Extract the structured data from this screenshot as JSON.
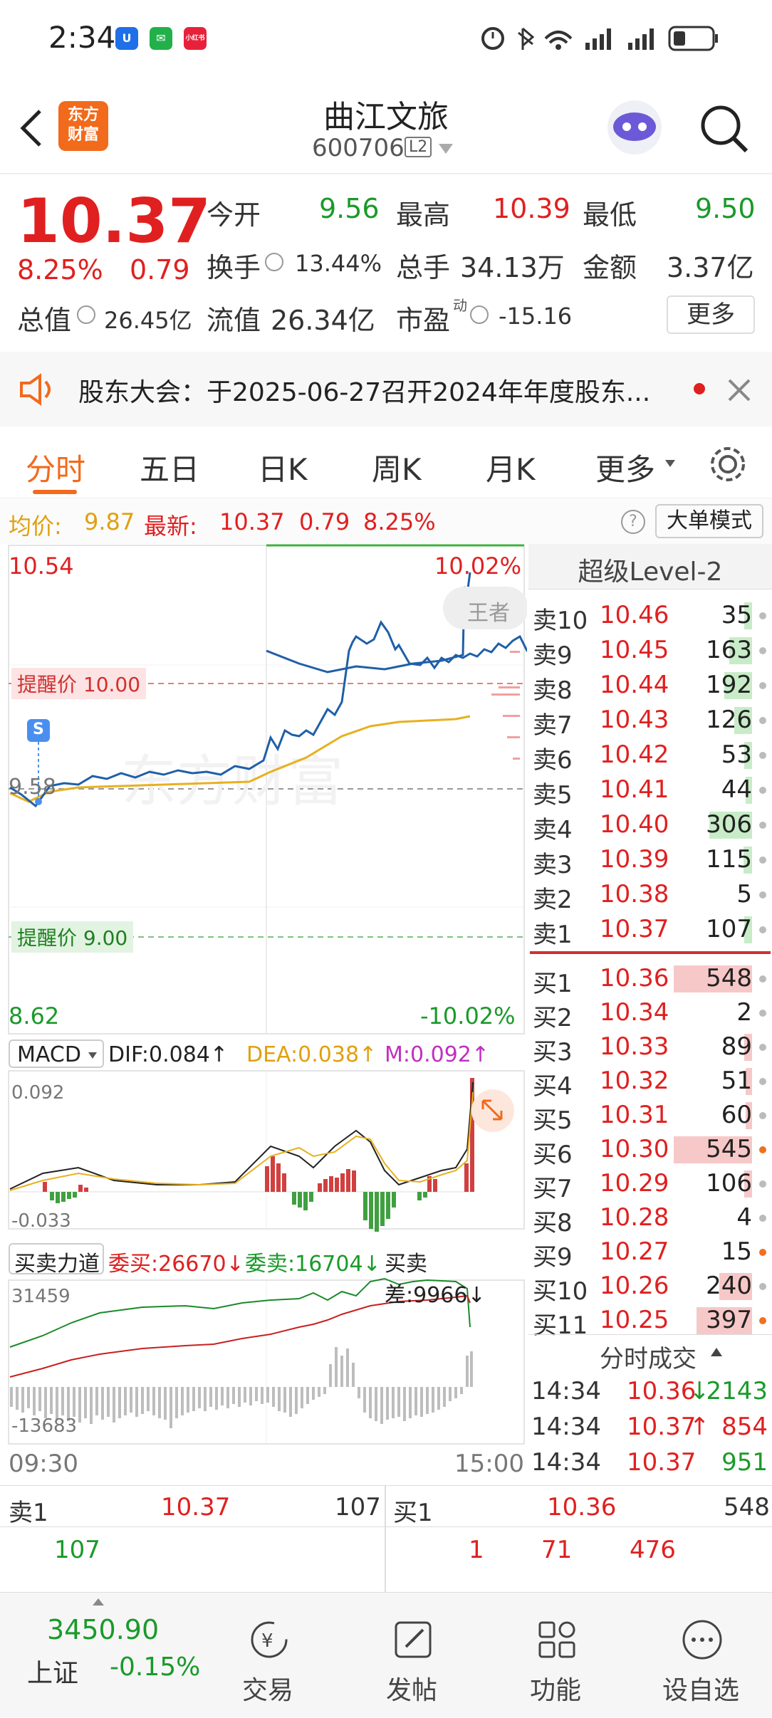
{
  "status_bar": {
    "time": "2:34",
    "badges": [
      "u-app-icon",
      "wechat-icon",
      "xiaohongshu-icon"
    ],
    "badge3_text": "小红书"
  },
  "header": {
    "back": "back-arrow",
    "logo_text_1": "东方",
    "logo_text_2": "财富",
    "stock_name": "曲江文旅",
    "stock_code": "600706",
    "level_tag": "L2"
  },
  "quote": {
    "price": "10.37",
    "pct": "8.25%",
    "change": "0.79",
    "open_label": "今开",
    "open": "9.56",
    "high_label": "最高",
    "high": "10.39",
    "low_label": "最低",
    "low": "9.50",
    "turnover_label": "换手",
    "turnover": "13.44%",
    "volume_label": "总手",
    "volume": "34.13万",
    "amount_label": "金额",
    "amount": "3.37亿",
    "mktcap_label": "总值",
    "mktcap": "26.45亿",
    "float_label": "流值",
    "float": "26.34亿",
    "pe_label": "市盈",
    "pe_sup": "动",
    "pe": "-15.16",
    "more": "更多"
  },
  "notice": {
    "text": "股东大会：于2025-06-27召开2024年年度股东..."
  },
  "tabs": [
    "分时",
    "五日",
    "日K",
    "周K",
    "月K",
    "更多"
  ],
  "infoline": {
    "avg_label": "均价:",
    "avg": "9.87",
    "latest_label": "最新:",
    "latest": "10.37",
    "chg": "0.79",
    "pct": "8.25%",
    "mode": "大单模式"
  },
  "chart": {
    "ymax": "10.54",
    "ymax_pct": "10.02%",
    "ymin": "8.62",
    "ymin_pct": "-10.02%",
    "alert_high": "提醒价 10.00",
    "alert_low": "提醒价 9.00",
    "ref": "9.58",
    "watermark": "东方财富",
    "overlay_tag": "王者",
    "s_marker": "S",
    "t_start": "09:30",
    "t_end": "15:00"
  },
  "macd": {
    "name": "MACD",
    "dif": "DIF:0.084",
    "dea": "DEA:0.038",
    "m": "M:0.092",
    "top": "0.092",
    "bottom": "-0.033"
  },
  "force": {
    "name": "买卖力道",
    "buy": "委买:26670",
    "sell": "委卖:16704",
    "diff": "买卖差:9966",
    "top": "31459",
    "bottom": "-13683"
  },
  "level2": {
    "title": "超级Level-2",
    "asks": [
      {
        "label": "卖10",
        "price": "10.46",
        "vol": "35",
        "w": 0.06
      },
      {
        "label": "卖9",
        "price": "10.45",
        "vol": "163",
        "w": 0.18
      },
      {
        "label": "卖8",
        "price": "10.44",
        "vol": "192",
        "w": 0.22
      },
      {
        "label": "卖7",
        "price": "10.43",
        "vol": "126",
        "w": 0.14
      },
      {
        "label": "卖6",
        "price": "10.42",
        "vol": "53",
        "w": 0.06
      },
      {
        "label": "卖5",
        "price": "10.41",
        "vol": "44",
        "w": 0.05
      },
      {
        "label": "卖4",
        "price": "10.40",
        "vol": "306",
        "w": 0.34
      },
      {
        "label": "卖3",
        "price": "10.39",
        "vol": "115",
        "w": 0.07
      },
      {
        "label": "卖2",
        "price": "10.38",
        "vol": "5",
        "w": 0.0
      },
      {
        "label": "卖1",
        "price": "10.37",
        "vol": "107",
        "w": 0.06
      }
    ],
    "bids": [
      {
        "label": "买1",
        "price": "10.36",
        "vol": "548",
        "w": 0.62,
        "dot": "gray"
      },
      {
        "label": "买2",
        "price": "10.34",
        "vol": "2",
        "w": 0.0,
        "dot": "gray"
      },
      {
        "label": "买3",
        "price": "10.33",
        "vol": "89",
        "w": 0.06,
        "dot": "gray"
      },
      {
        "label": "买4",
        "price": "10.32",
        "vol": "51",
        "w": 0.05,
        "dot": "gray"
      },
      {
        "label": "买5",
        "price": "10.31",
        "vol": "60",
        "w": 0.05,
        "dot": "gray"
      },
      {
        "label": "买6",
        "price": "10.30",
        "vol": "545",
        "w": 0.62,
        "dot": "orange"
      },
      {
        "label": "买7",
        "price": "10.29",
        "vol": "106",
        "w": 0.06,
        "dot": "gray"
      },
      {
        "label": "买8",
        "price": "10.28",
        "vol": "4",
        "w": 0.0,
        "dot": "gray"
      },
      {
        "label": "买9",
        "price": "10.27",
        "vol": "15",
        "w": 0.0,
        "dot": "orange"
      },
      {
        "label": "买10",
        "price": "10.26",
        "vol": "240",
        "w": 0.26,
        "dot": "gray"
      },
      {
        "label": "买11",
        "price": "10.25",
        "vol": "397",
        "w": 0.44,
        "dot": "orange"
      }
    ],
    "ticks_title": "分时成交",
    "ticks": [
      {
        "time": "14:34",
        "price": "10.36",
        "arrow": "↓",
        "vol": "2143",
        "color": "green"
      },
      {
        "time": "14:34",
        "price": "10.37",
        "arrow": "↑",
        "vol": "854",
        "color": "red"
      },
      {
        "time": "14:34",
        "price": "10.37",
        "arrow": "",
        "vol": "951",
        "color": "green"
      }
    ]
  },
  "bottom_quote": {
    "ask_label": "卖1",
    "ask_price": "10.37",
    "ask_vol": "107",
    "bid_label": "买1",
    "bid_price": "10.36",
    "bid_vol": "548",
    "ask_detail": "107",
    "bid_detail": [
      "1",
      "71",
      "476"
    ]
  },
  "nav": {
    "index_value": "3450.90",
    "index_name": "上证",
    "index_pct": "-0.15%",
    "items": [
      "交易",
      "发帖",
      "功能",
      "设自选"
    ]
  }
}
